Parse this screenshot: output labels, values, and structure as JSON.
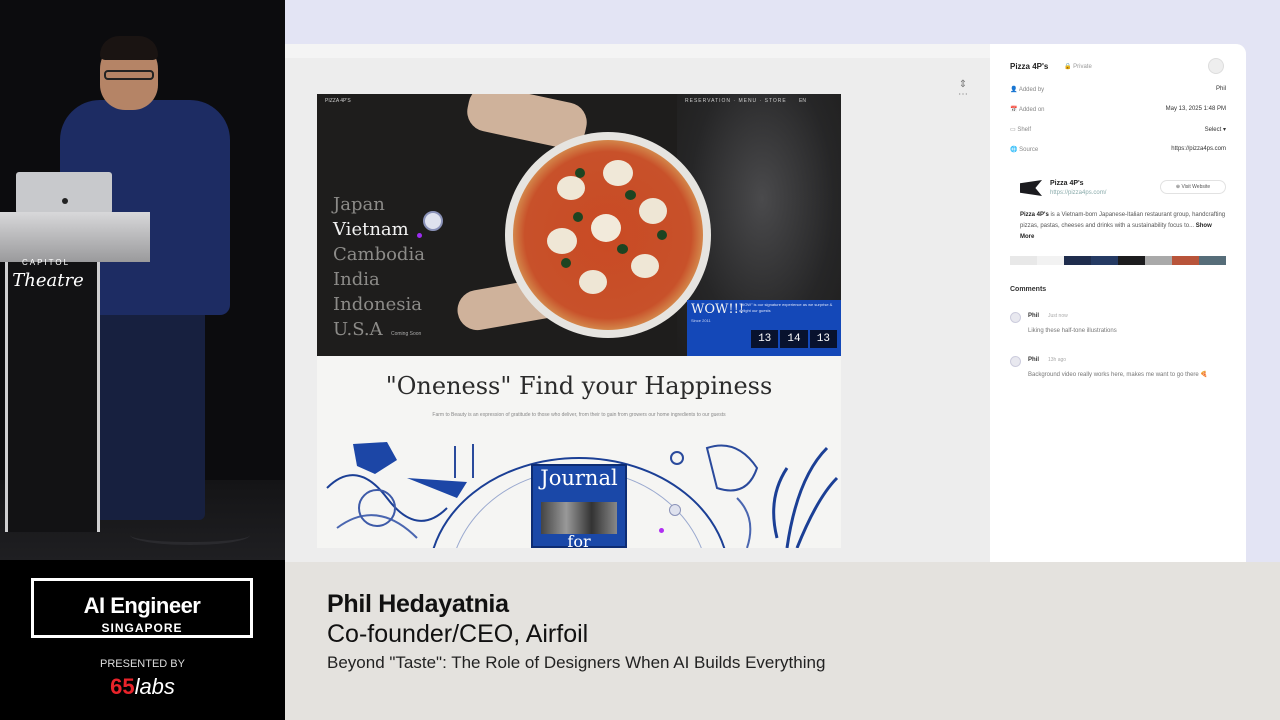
{
  "speaker_video": {
    "podium_brand_top": "CAPITOL",
    "podium_brand": "Theatre"
  },
  "hero": {
    "brand": "PIZZA 4P'S",
    "nav_links": "RESERVATION · MENU · STORE",
    "nav_lang": "EN",
    "cities": [
      "Japan",
      "Vietnam",
      "Cambodia",
      "India",
      "Indonesia",
      "U.S.A"
    ],
    "active_city": "Vietnam",
    "coming_soon": "Coming Soon",
    "promo": {
      "title": "WOW!!!",
      "subtitle": "Since 2011",
      "text": "\"WOW\" is our signature experience as we surprise & delight our guests",
      "countdown": [
        "13",
        "14",
        "13"
      ]
    }
  },
  "section": {
    "headline": "\"Oneness\" Find your Happiness",
    "subtext": "Farm to Beauty is an expression of gratitude to those who deliver, from their to gain from growers our home ingredients to our guests",
    "journal_title": "Journal",
    "journal_for": "for"
  },
  "details": {
    "title": "Pizza 4P's",
    "visibility": "Private",
    "rows": [
      {
        "label": "Added by",
        "value": "Phil"
      },
      {
        "label": "Added on",
        "value": "May 13, 2025 1:48 PM"
      },
      {
        "label": "Shelf",
        "value": "Select"
      },
      {
        "label": "Source",
        "value": "https://pizza4ps.com"
      }
    ],
    "card": {
      "name": "Pizza 4P's",
      "url": "https://pizza4ps.com/",
      "visit": "Visit Website",
      "desc_bold": "Pizza 4P's",
      "desc": "is a Vietnam-born Japanese-Italian restaurant group, handcrafting pizzas, pastas, cheeses and drinks with a sustainability focus to...",
      "show_more": "Show More"
    },
    "palette": [
      "#e8e8e8",
      "#f2f2f2",
      "#1f2d4d",
      "#253a63",
      "#1c1c1e",
      "#a9a9a9",
      "#b8543a",
      "#566d79"
    ],
    "comments_header": "Comments",
    "comments": [
      {
        "who": "Phil",
        "when": "Just now",
        "text": "Liking these half-tone illustrations"
      },
      {
        "who": "Phil",
        "when": "13h ago",
        "text": "Background video really works here, makes me want to go there 🍕"
      }
    ]
  },
  "branding": {
    "event_title": "AI Engineer",
    "event_city": "SINGAPORE",
    "presented_by": "PRESENTED BY",
    "sponsor_num": "65",
    "sponsor_word": "labs"
  },
  "lower_third": {
    "name": "Phil Hedayatnia",
    "role": "Co-founder/CEO, Airfoil",
    "talk": "Beyond \"Taste\": The Role of Designers When AI Builds Everything"
  }
}
